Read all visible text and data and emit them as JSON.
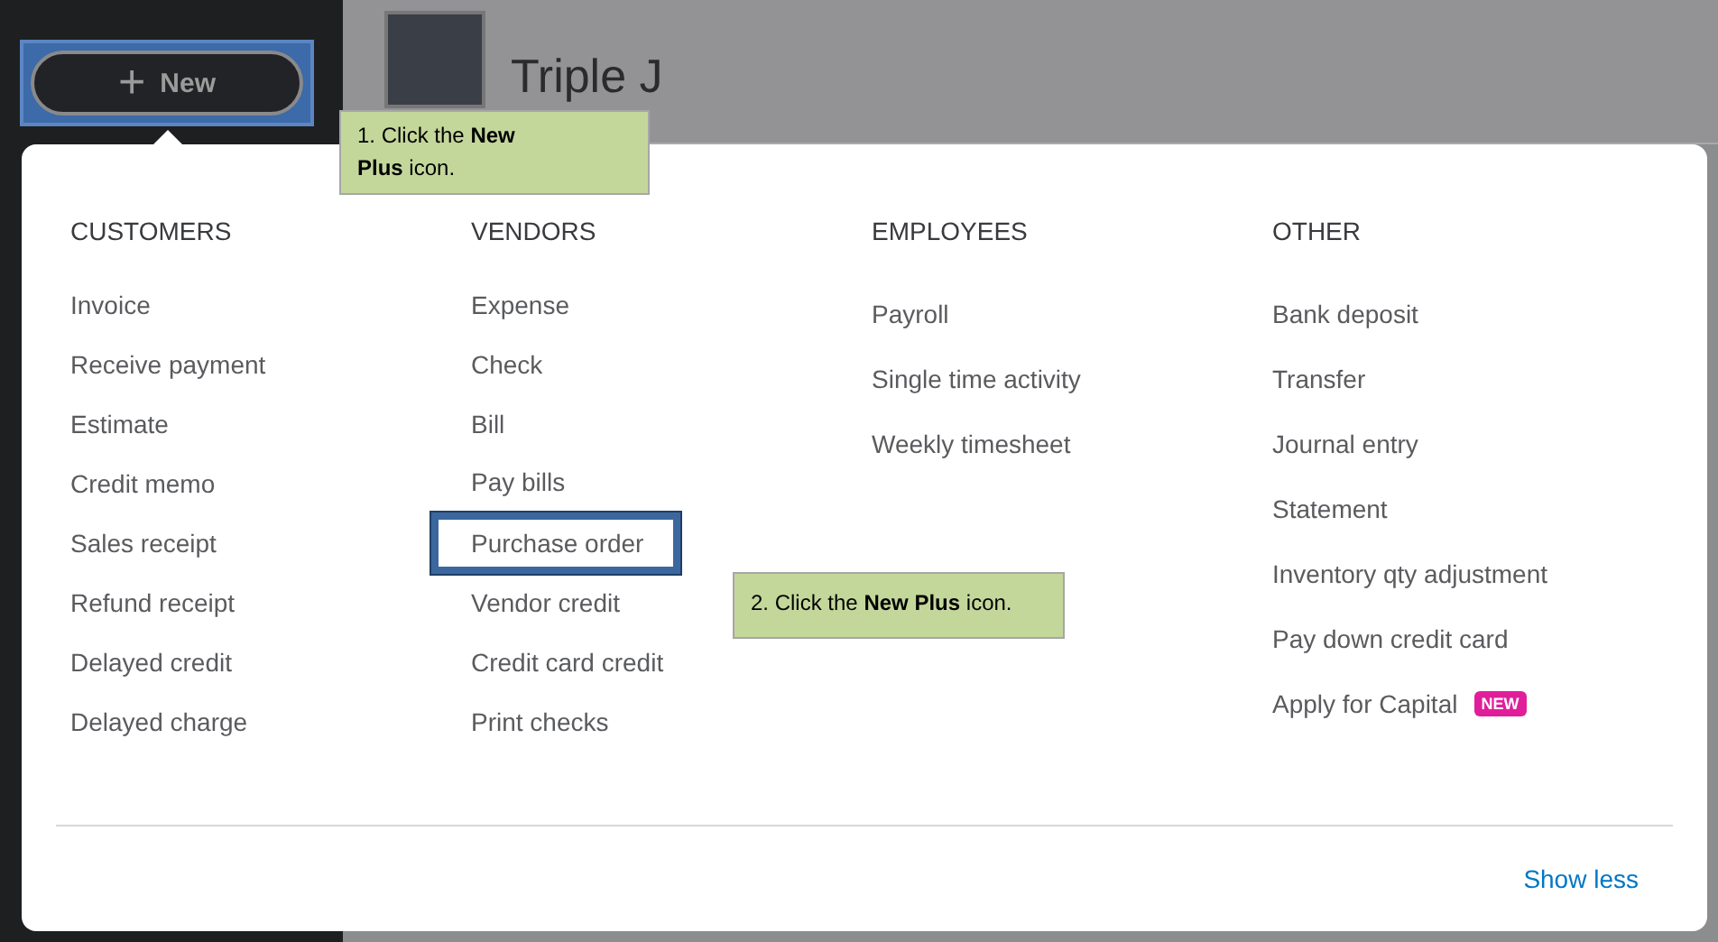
{
  "new_button": {
    "icon": "+",
    "label": "New",
    "highlighted": true
  },
  "company": {
    "name": "Triple J"
  },
  "menu": {
    "columns": [
      {
        "heading": "CUSTOMERS",
        "items": [
          {
            "label": "Invoice",
            "selected": false
          },
          {
            "label": "Receive payment",
            "selected": false
          },
          {
            "label": "Estimate",
            "selected": false
          },
          {
            "label": "Credit memo",
            "selected": false
          },
          {
            "label": "Sales receipt",
            "selected": false
          },
          {
            "label": "Refund receipt",
            "selected": false
          },
          {
            "label": "Delayed credit",
            "selected": false
          },
          {
            "label": "Delayed charge",
            "selected": false
          }
        ]
      },
      {
        "heading": "VENDORS",
        "items": [
          {
            "label": "Expense",
            "selected": false
          },
          {
            "label": "Check",
            "selected": false
          },
          {
            "label": "Bill",
            "selected": false
          },
          {
            "label": "Pay bills",
            "selected": false
          },
          {
            "label": "Purchase order",
            "selected": true
          },
          {
            "label": "Vendor credit",
            "selected": false
          },
          {
            "label": "Credit card credit",
            "selected": false
          },
          {
            "label": "Print checks",
            "selected": false
          }
        ]
      },
      {
        "heading": "EMPLOYEES",
        "items": [
          {
            "label": "Payroll",
            "selected": false
          },
          {
            "label": "Single time activity",
            "selected": false
          },
          {
            "label": "Weekly timesheet",
            "selected": false
          }
        ]
      },
      {
        "heading": "OTHER",
        "items": [
          {
            "label": "Bank deposit",
            "selected": false
          },
          {
            "label": "Transfer",
            "selected": false
          },
          {
            "label": "Journal entry",
            "selected": false
          },
          {
            "label": "Statement",
            "selected": false
          },
          {
            "label": "Inventory qty adjustment",
            "selected": false
          },
          {
            "label": "Pay down credit card",
            "selected": false
          },
          {
            "label": "Apply for Capital",
            "selected": false,
            "badge": "NEW"
          }
        ]
      }
    ],
    "show_less": "Show less"
  },
  "callouts": [
    {
      "text": "1. Click the **New Plus** icon."
    },
    {
      "text": "2. Click the **New Plus** icon."
    }
  ]
}
